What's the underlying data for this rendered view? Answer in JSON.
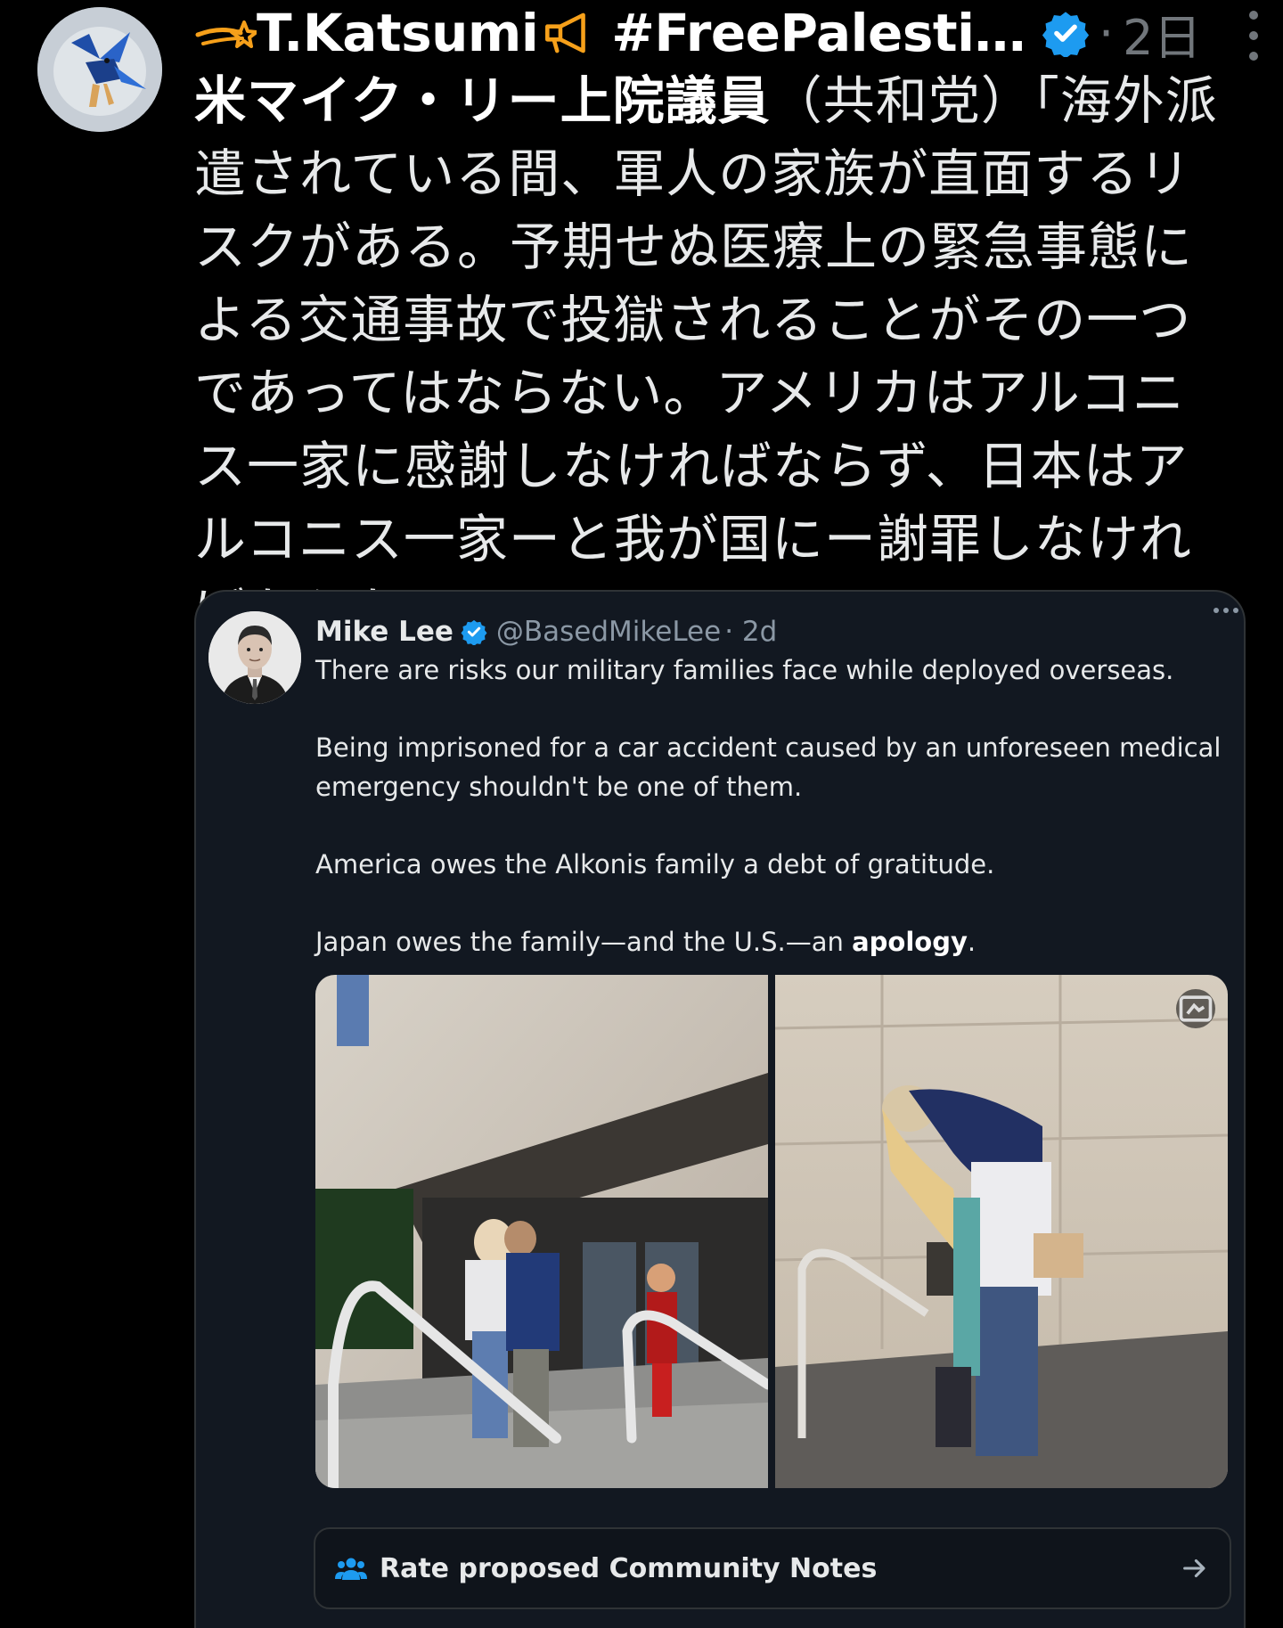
{
  "post": {
    "author_display_name": "T.Katsumi",
    "author_hashtag": "#FreePalesti…",
    "time_sep": "·",
    "time_ago": "2日",
    "body_bold": "米マイク・リー上院議員",
    "body_rest": "（共和党）「海外派遣されている間、軍人の家族が直面するリスクがある。予期せぬ医療上の緊急事態による交通事故で投獄されることがその一つであってはならない。アメリカはアルコニス一家に感謝しなければならず、日本はアルコニス一家ーと我が国にー謝罪しなければならない」"
  },
  "quote": {
    "name": "Mike Lee",
    "handle": "@BasedMikeLee",
    "time": "· 2d",
    "p1": "There are risks our military families face while deployed overseas.",
    "p2": "Being imprisoned for a car accident caused by an unforeseen medical emergency shouldn't be one of them.",
    "p3": "America owes the Alkonis family a debt of gratitude.",
    "p4_start": "Japan owes the family—and the U.S.—an ",
    "p4_bold": "apology",
    "p4_end": "."
  },
  "community_notes": {
    "label": "Rate proposed Community Notes"
  },
  "icons": {
    "verified": "verified-badge-icon",
    "more": "more-options-icon",
    "community": "people-icon",
    "arrow": "arrow-right-icon"
  },
  "colors": {
    "verified_blue": "#1d9bf0",
    "accent_orange": "#f6a01a",
    "community_icon": "#1d9bf0"
  }
}
